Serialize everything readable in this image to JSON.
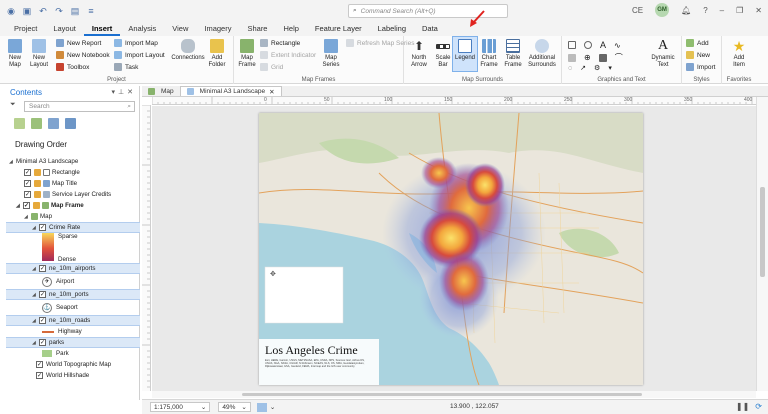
{
  "titlebar": {
    "command_search_placeholder": "Command Search (Alt+Q)",
    "user_initials_left": "CE",
    "user_avatar": "GM",
    "help": "?",
    "minimize": "–",
    "restore": "❐",
    "close": "✕"
  },
  "ribbon_tabs": [
    "Project",
    "Layout",
    "Insert",
    "Analysis",
    "View",
    "Imagery",
    "Share",
    "Help",
    "Feature Layer",
    "Labeling",
    "Data"
  ],
  "active_tab": "Insert",
  "ribbon": {
    "project": {
      "title": "Project",
      "new_map": "New Map",
      "new_layout": "New Layout",
      "new_report": "New Report",
      "new_notebook": "New Notebook",
      "toolbox": "Toolbox",
      "import_map": "Import Map",
      "import_layout": "Import Layout",
      "task": "Task",
      "connections": "Connections",
      "add_folder": "Add Folder"
    },
    "map_frames": {
      "title": "Map Frames",
      "map_frame": "Map Frame",
      "rectangle": "Rectangle",
      "extent_indicator": "Extent Indicator",
      "grid": "Grid",
      "map_series": "Map Series",
      "refresh_map_series": "Refresh Map Series"
    },
    "map_surrounds": {
      "title": "Map Surrounds",
      "north_arrow": "North Arrow",
      "scale_bar": "Scale Bar",
      "legend": "Legend",
      "chart_frame": "Chart Frame",
      "table_frame": "Table Frame",
      "additional_surrounds": "Additional Surrounds"
    },
    "graphics_text": {
      "title": "Graphics and Text",
      "dynamic_text": "Dynamic Text"
    },
    "styles": {
      "title": "Styles",
      "add": "Add",
      "new": "New",
      "import": "Import"
    },
    "favorites": {
      "title": "Favorites",
      "add_item": "Add Item"
    }
  },
  "contents": {
    "title": "Contents",
    "search_placeholder": "Search",
    "section": "Drawing Order",
    "layers": [
      {
        "label": "Minimal A3 Landscape"
      },
      {
        "label": "Rectangle"
      },
      {
        "label": "Map Title"
      },
      {
        "label": "Service Layer Credits"
      },
      {
        "label": "Map Frame"
      },
      {
        "label": "Map"
      },
      {
        "label": "Crime Rate"
      },
      {
        "label": "Sparse"
      },
      {
        "label": "Dense"
      },
      {
        "label": "ne_10m_airports"
      },
      {
        "label": "Airport"
      },
      {
        "label": "ne_10m_ports"
      },
      {
        "label": "Seaport"
      },
      {
        "label": "ne_10m_roads"
      },
      {
        "label": "Highway"
      },
      {
        "label": "parks"
      },
      {
        "label": "Park"
      },
      {
        "label": "World Topographic Map"
      },
      {
        "label": "World Hillshade"
      }
    ]
  },
  "doc_tabs": [
    "Map",
    "Minimal A3 Landscape"
  ],
  "ruler_labels": [
    "0",
    "50",
    "100",
    "150",
    "200",
    "250",
    "300",
    "350",
    "400"
  ],
  "map_title": "Los Angeles Crime",
  "map_credits": "Esri, HERE, Garmin, USGS, METI/NASA, EPA, USDA, NPS, Sources: Esri, Airbus DS, USGS, NGA, NASA, CGIAR, N Robinson, NCEAS, NLS, OS, NMA, Geodatastyrelsen, Rijkswaterstaat, GSA, Geoland, FEMA, Intermap and the GIS user community",
  "status": {
    "scale": "1:175,000",
    "zoom": "49%",
    "coordinates": "13.900 , 122.057"
  }
}
